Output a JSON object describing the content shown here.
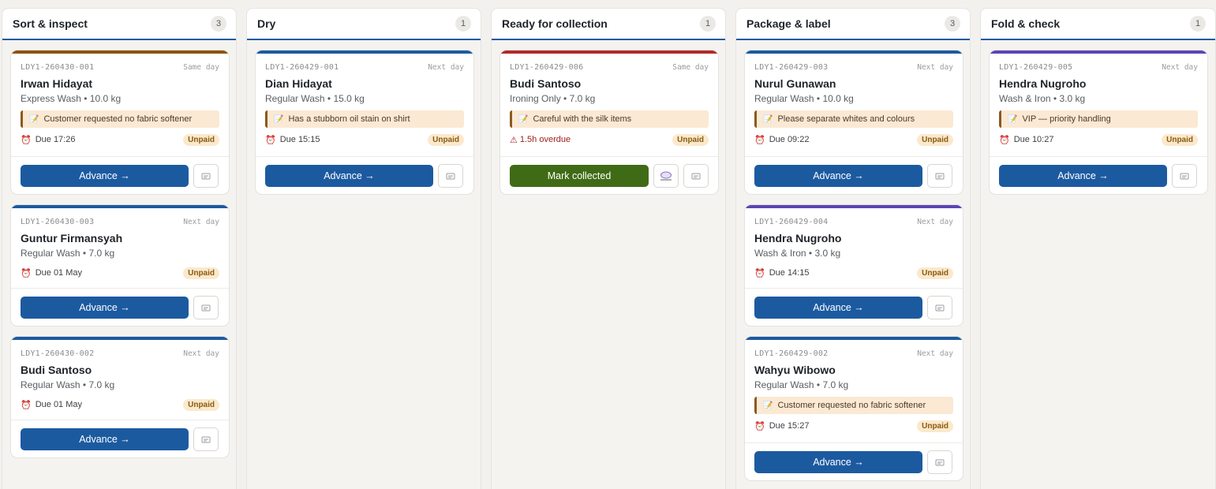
{
  "columns": [
    {
      "title": "Sort & inspect",
      "count": "3",
      "cards": [
        {
          "id": "LDY1-260430-001",
          "speed": "Same day",
          "customer": "Irwan Hidayat",
          "service": "Express Wash • 10.0 kg",
          "note": "Customer requested no fabric softener",
          "due": "Due 17:26",
          "payment": "Unpaid",
          "action": "Advance →",
          "stripe": "#8a5412"
        },
        {
          "id": "LDY1-260430-003",
          "speed": "Next day",
          "customer": "Guntur Firmansyah",
          "service": "Regular Wash • 7.0 kg",
          "note": null,
          "due": "Due 01 May",
          "payment": "Unpaid",
          "action": "Advance →",
          "stripe": "#1c5aa0"
        },
        {
          "id": "LDY1-260430-002",
          "speed": "Next day",
          "customer": "Budi Santoso",
          "service": "Regular Wash • 7.0 kg",
          "note": null,
          "due": "Due 01 May",
          "payment": "Unpaid",
          "action": "Advance →",
          "stripe": "#1c5aa0"
        }
      ]
    },
    {
      "title": "Dry",
      "count": "1",
      "cards": [
        {
          "id": "LDY1-260429-001",
          "speed": "Next day",
          "customer": "Dian Hidayat",
          "service": "Regular Wash • 15.0 kg",
          "note": "Has a stubborn oil stain on shirt",
          "due": "Due 15:15",
          "payment": "Unpaid",
          "action": "Advance →",
          "stripe": "#1c5aa0"
        }
      ]
    },
    {
      "title": "Ready for collection",
      "count": "1",
      "cards": [
        {
          "id": "LDY1-260429-006",
          "speed": "Same day",
          "customer": "Budi Santoso",
          "service": "Ironing Only • 7.0 kg",
          "note": "Careful with the silk items",
          "due": "1.5h overdue",
          "overdue": true,
          "payment": "Unpaid",
          "action": "Mark collected",
          "stripe": "#b02a2a"
        }
      ]
    },
    {
      "title": "Package & label",
      "count": "3",
      "cards": [
        {
          "id": "LDY1-260429-003",
          "speed": "Next day",
          "customer": "Nurul Gunawan",
          "service": "Regular Wash • 10.0 kg",
          "note": "Please separate whites and colours",
          "due": "Due 09:22",
          "payment": "Unpaid",
          "action": "Advance →",
          "stripe": "#1c5aa0"
        },
        {
          "id": "LDY1-260429-004",
          "speed": "Next day",
          "customer": "Hendra Nugroho",
          "service": "Wash & Iron • 3.0 kg",
          "note": null,
          "due": "Due 14:15",
          "payment": "Unpaid",
          "action": "Advance →",
          "stripe": "#5b45b5"
        },
        {
          "id": "LDY1-260429-002",
          "speed": "Next day",
          "customer": "Wahyu Wibowo",
          "service": "Regular Wash • 7.0 kg",
          "note": "Customer requested no fabric softener",
          "due": "Due 15:27",
          "payment": "Unpaid",
          "action": "Advance →",
          "stripe": "#1c5aa0"
        }
      ]
    },
    {
      "title": "Fold & check",
      "count": "1",
      "cards": [
        {
          "id": "LDY1-260429-005",
          "speed": "Next day",
          "customer": "Hendra Nugroho",
          "service": "Wash & Iron • 3.0 kg",
          "note": "VIP — priority handling",
          "due": "Due 10:27",
          "payment": "Unpaid",
          "action": "Advance →",
          "stripe": "#5b45b5"
        }
      ]
    }
  ],
  "icons": {
    "note": "memo-icon",
    "due": "alarm-clock-icon",
    "overdue": "warning-icon",
    "print": "print-label-icon",
    "message": "chat-bubble-icon"
  }
}
